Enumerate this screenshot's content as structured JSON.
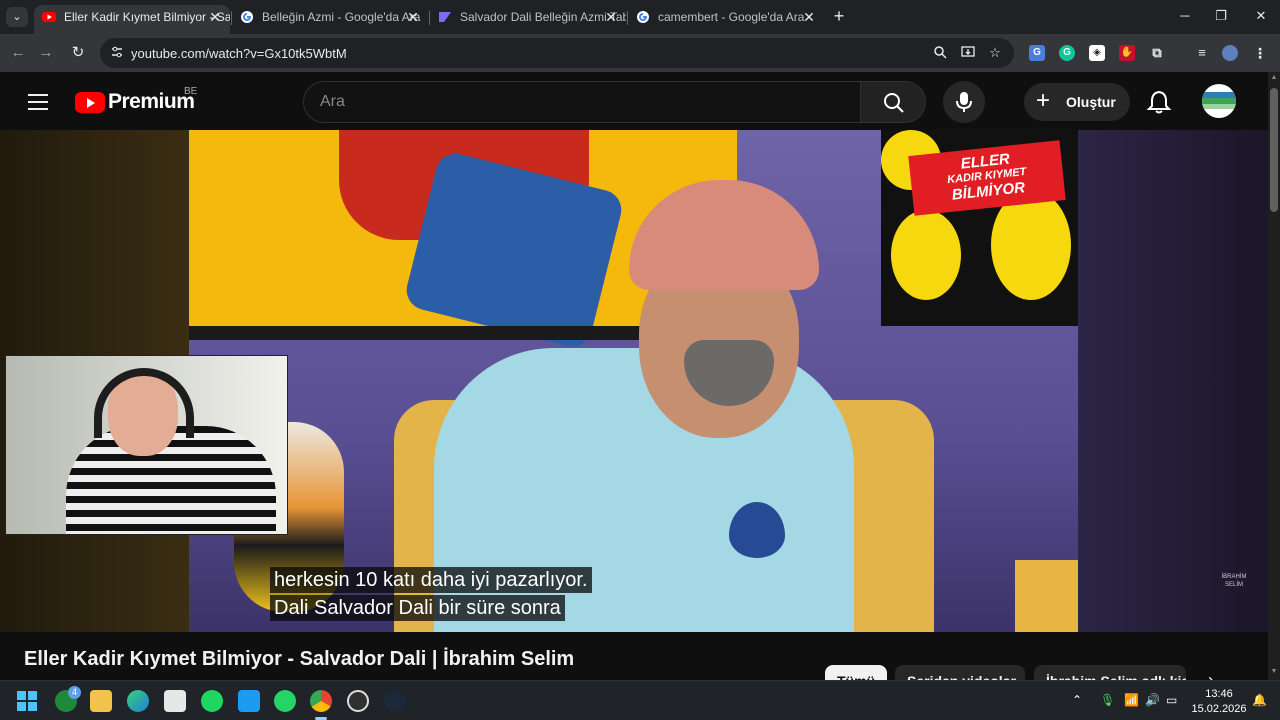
{
  "browser": {
    "tabs": [
      {
        "title": "Eller Kadir Kıymet Bilmiyor - Sal",
        "favicon": "youtube-icon",
        "active": true
      },
      {
        "title": "Belleğin Azmi - Google'da Ara",
        "favicon": "google-icon",
        "active": false
      },
      {
        "title": "Salvador Dali Belleğin Azmi Tab",
        "favicon": "app-icon",
        "active": false
      },
      {
        "title": "camembert - Google'da Ara",
        "favicon": "google-icon",
        "active": false
      }
    ],
    "close_glyph": "✕",
    "url": "youtube.com/watch?v=Gx10tk5WbtM"
  },
  "youtube": {
    "logo_text": "Premium",
    "country": "BE",
    "search_placeholder": "Ara",
    "create_label": "Oluştur"
  },
  "video": {
    "badge_lines": [
      "ELLER",
      "KADIR KIYMET",
      "BİLMİYOR"
    ],
    "subtitles": [
      "herkesin 10 katı daha iyi pazarlıyor.",
      "Dali Salvador Dali bir süre sonra"
    ],
    "watermark": "İBRAHİM SELİM",
    "title": "Eller Kadir Kıymet Bilmiyor - Salvador Dali | İbrahim Selim"
  },
  "chips": [
    {
      "label": "Tümü",
      "active": true
    },
    {
      "label": "Seriden videolar",
      "active": false
    },
    {
      "label": "İbrahim Selim adlı kişiden",
      "active": false
    }
  ],
  "taskbar": {
    "xbox_badge": "4",
    "time": "13:46",
    "date": "15.02.2026"
  },
  "colors": {
    "youtube_red": "#ff0000",
    "chrome_dark": "#202124",
    "badge_red": "#e01e24"
  }
}
